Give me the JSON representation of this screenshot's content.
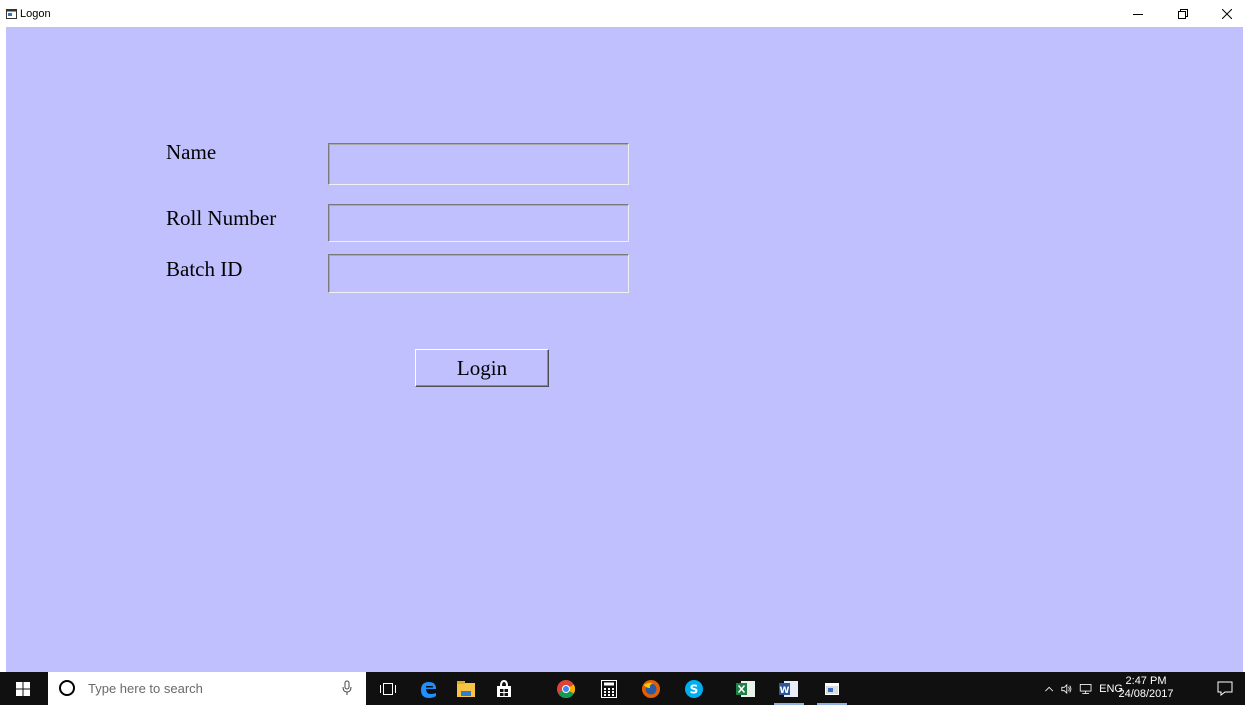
{
  "window": {
    "title": "Logon",
    "controls": [
      "minimize-icon",
      "restore-icon",
      "close-icon"
    ]
  },
  "form": {
    "name_label": "Name",
    "roll_label": "Roll Number",
    "batch_label": "Batch ID",
    "name_value": "",
    "roll_value": "",
    "batch_value": "",
    "login_label": "Login"
  },
  "taskbar": {
    "search_placeholder": "Type here to search",
    "pinned": [
      "task-view-icon",
      "edge-icon",
      "file-explorer-icon",
      "store-icon",
      "chrome-icon",
      "calculator-icon",
      "firefox-icon",
      "skype-icon",
      "excel-icon",
      "word-icon",
      "logon-app-icon"
    ],
    "tray": {
      "language": "ENG",
      "time": "2:47 PM",
      "date": "24/08/2017"
    }
  },
  "colors": {
    "form_background": "#c0c0fe",
    "taskbar": "#101010"
  }
}
